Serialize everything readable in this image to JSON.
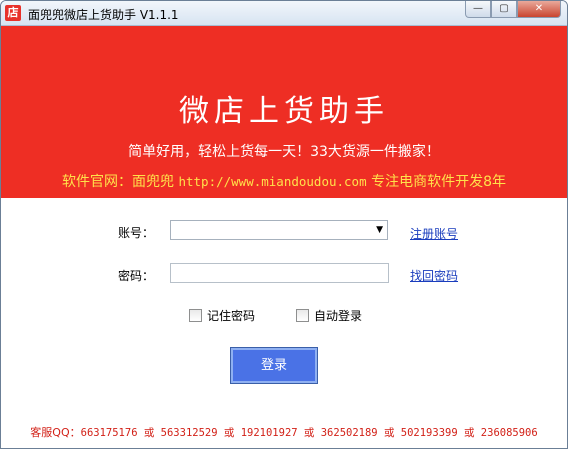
{
  "window": {
    "title": "面兜兜微店上货助手 V1.1.1",
    "icon_glyph": "店",
    "min_glyph": "—",
    "max_glyph": "▢",
    "close_glyph": "✕"
  },
  "banner": {
    "title": "微店上货助手",
    "subtitle": "简单好用，轻松上货每一天！33大货源一件搬家！",
    "site_prefix": "软件官网：面兜兜 ",
    "site_url": "http://www.miandoudou.com",
    "site_suffix": " 专注电商软件开发8年",
    "background": "#ee2e24",
    "site_color": "#ffe14a"
  },
  "form": {
    "account_label": "账号：",
    "account_value": "",
    "password_label": "密码：",
    "password_value": "",
    "register_link": "注册账号",
    "recover_link": "找回密码",
    "remember_label": "记住密码",
    "auto_login_label": "自动登录",
    "login_button": "登录"
  },
  "footer": {
    "prefix": "客服QQ：",
    "text": "663175176 或 563312529 或 192101927 或 362502189 或 502193399 或 236085906"
  }
}
